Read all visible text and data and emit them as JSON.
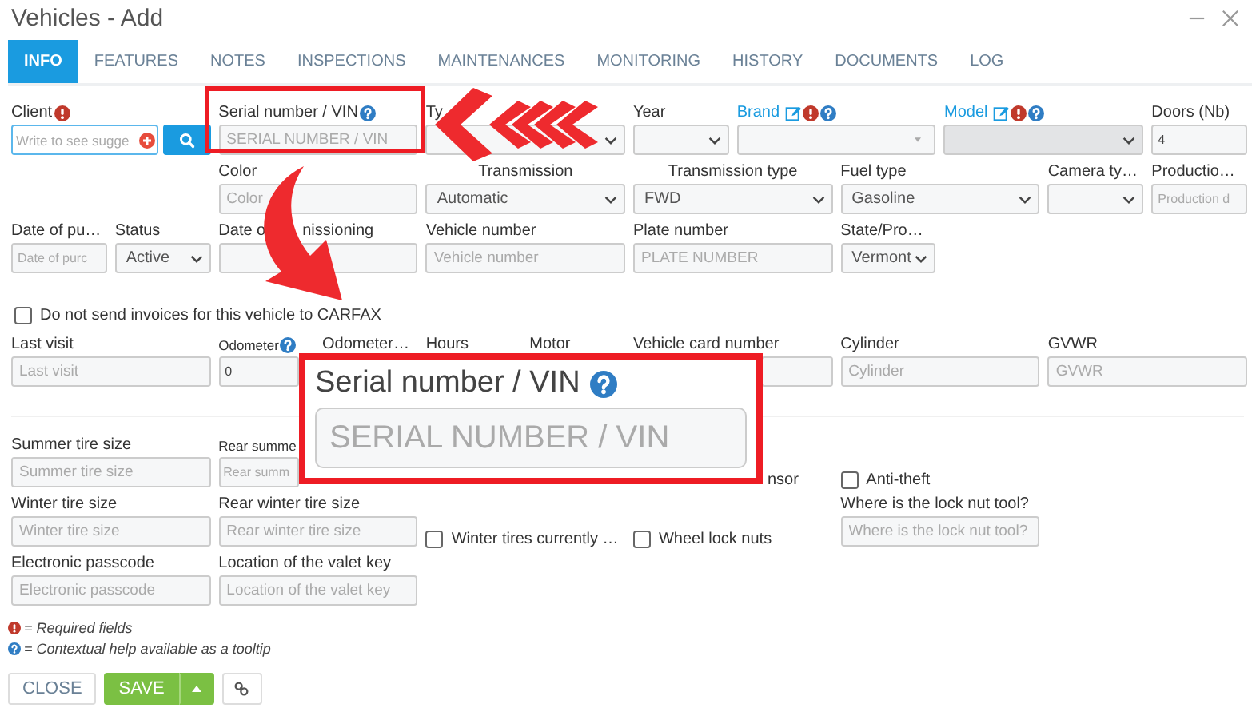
{
  "window": {
    "title": "Vehicles - Add"
  },
  "tabs": [
    {
      "label": "INFO",
      "selected": true
    },
    {
      "label": "FEATURES",
      "selected": false
    },
    {
      "label": "NOTES",
      "selected": false
    },
    {
      "label": "INSPECTIONS",
      "selected": false
    },
    {
      "label": "MAINTENANCES",
      "selected": false
    },
    {
      "label": "MONITORING",
      "selected": false
    },
    {
      "label": "HISTORY",
      "selected": false
    },
    {
      "label": "DOCUMENTS",
      "selected": false
    },
    {
      "label": "LOG",
      "selected": false
    }
  ],
  "rows": [
    {
      "fields": [
        {
          "kind": "lookup",
          "label": "Client",
          "required": true,
          "placeholder": "Write to see sugge",
          "focused": true
        },
        {
          "kind": "input",
          "label": "Serial number / VIN",
          "help": true,
          "placeholder": "SERIAL NUMBER / VIN"
        },
        {
          "kind": "select",
          "label": "Ty"
        },
        {
          "kind": "select",
          "label": "Year"
        },
        {
          "kind": "combo",
          "label": "Brand",
          "link": true,
          "editable": true,
          "required": true,
          "help": true
        },
        {
          "kind": "select",
          "label": "Model",
          "link": true,
          "editable": true,
          "required": true,
          "help": true,
          "disabled": true
        },
        {
          "kind": "input",
          "label": "Doors (Nb)",
          "value": "4"
        }
      ]
    },
    {
      "fields": [
        {
          "kind": "input",
          "label": "Color",
          "placeholder": "Color"
        },
        {
          "kind": "select",
          "label": "Transmission",
          "value": "Automatic"
        },
        {
          "kind": "select",
          "label": "Transmission type",
          "value": "FWD"
        },
        {
          "kind": "select",
          "label": "Fuel type",
          "value": "Gasoline"
        },
        {
          "kind": "select",
          "label": "Camera ty…"
        },
        {
          "kind": "input",
          "label": "Productio…",
          "placeholder": "Production d"
        }
      ]
    },
    {
      "fields": [
        {
          "kind": "input",
          "label": "Date of pu…",
          "placeholder": "Date of purc"
        },
        {
          "kind": "select",
          "label": "Status",
          "value": "Active"
        },
        {
          "kind": "input",
          "label": "Date o",
          "label_tail": "nissioning"
        },
        {
          "kind": "input",
          "label": "Vehicle number",
          "placeholder": "Vehicle number"
        },
        {
          "kind": "input",
          "label": "Plate number",
          "placeholder": "PLATE NUMBER"
        },
        {
          "kind": "select",
          "label": "State/Pro…",
          "value": "Vermont"
        }
      ]
    }
  ],
  "invoice_option": {
    "label": "Do not send invoices for this vehicle to CARFAX",
    "checked": false
  },
  "usage_row": {
    "fields": [
      {
        "kind": "input",
        "label": "Last visit",
        "placeholder": "Last visit"
      },
      {
        "kind": "input",
        "label": "Odometer",
        "help": true,
        "value": "0"
      },
      {
        "kind": "label",
        "label": "Odometer…"
      },
      {
        "kind": "label",
        "label": "Hours"
      },
      {
        "kind": "label",
        "label": "Motor"
      },
      {
        "kind": "input",
        "label": "Vehicle card number"
      },
      {
        "kind": "input",
        "label": "Cylinder",
        "placeholder": "Cylinder"
      },
      {
        "kind": "input",
        "label": "GVWR",
        "placeholder": "GVWR"
      }
    ]
  },
  "tire_rows": [
    {
      "fields": [
        {
          "kind": "input",
          "label": "Summer tire size",
          "placeholder": "Summer tire size"
        },
        {
          "kind": "input",
          "label": "Rear summe",
          "placeholder": "Rear summ"
        },
        {
          "kind": "fragment",
          "label": "nsor"
        },
        {
          "kind": "checkbox",
          "label": "Anti-theft",
          "checked": false
        }
      ]
    },
    {
      "fields": [
        {
          "kind": "input",
          "label": "Winter tire size",
          "placeholder": "Winter tire size"
        },
        {
          "kind": "input",
          "label": "Rear winter tire size",
          "placeholder": "Rear winter tire size"
        },
        {
          "kind": "checkbox",
          "label": "Winter tires currently …",
          "checked": false
        },
        {
          "kind": "checkbox",
          "label": "Wheel lock nuts",
          "checked": false
        },
        {
          "kind": "input",
          "label": "Where is the lock nut tool?",
          "placeholder": "Where is the lock nut tool?"
        }
      ]
    },
    {
      "fields": [
        {
          "kind": "input",
          "label": "Electronic passcode",
          "placeholder": "Electronic passcode"
        },
        {
          "kind": "input",
          "label": "Location of the valet key",
          "placeholder": "Location of the valet key"
        }
      ]
    }
  ],
  "legend": [
    {
      "kind": "required",
      "text": "= Required fields"
    },
    {
      "kind": "help",
      "text": "= Contextual help available as a tooltip"
    }
  ],
  "buttons": [
    {
      "kind": "close",
      "label": "CLOSE"
    },
    {
      "kind": "save",
      "label": "SAVE"
    },
    {
      "kind": "link"
    }
  ],
  "callout": {
    "label": "Serial number / VIN",
    "help": true,
    "placeholder": "SERIAL NUMBER / VIN"
  }
}
